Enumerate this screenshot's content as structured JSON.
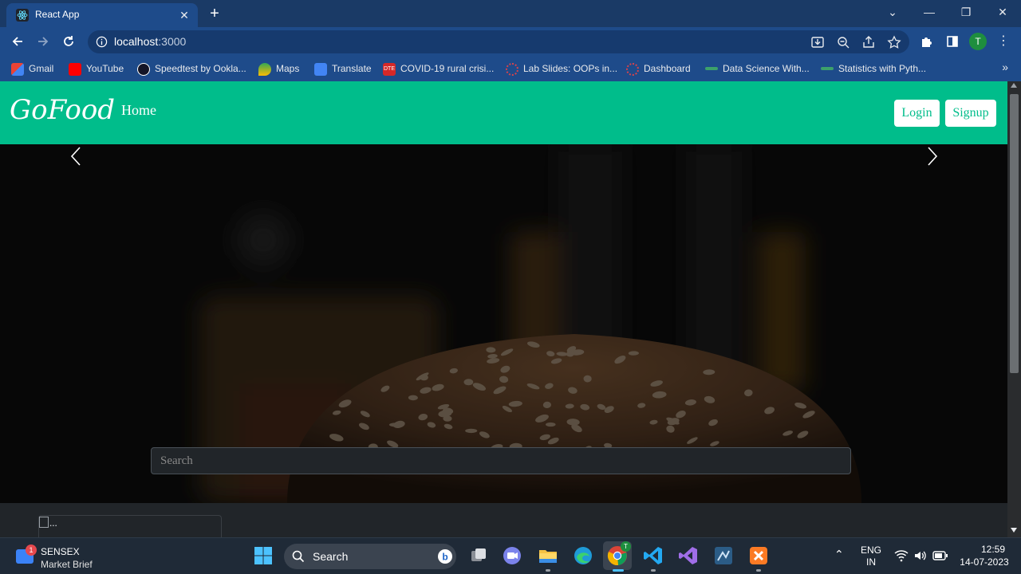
{
  "browser": {
    "tab_title": "React App",
    "url_host": "localhost",
    "url_port": ":3000",
    "profile_initial": "T",
    "bookmarks": [
      {
        "label": "Gmail",
        "icon": "gmail-icon"
      },
      {
        "label": "YouTube",
        "icon": "youtube-icon"
      },
      {
        "label": "Speedtest by Ookla...",
        "icon": "speedtest-icon"
      },
      {
        "label": "Maps",
        "icon": "maps-icon"
      },
      {
        "label": "Translate",
        "icon": "translate-icon"
      },
      {
        "label": "COVID-19 rural crisi...",
        "icon": "dte-icon"
      },
      {
        "label": "Lab Slides: OOPs in...",
        "icon": "lab-icon"
      },
      {
        "label": "Dashboard",
        "icon": "dashboard-icon"
      },
      {
        "label": "Data Science With...",
        "icon": "link-icon"
      },
      {
        "label": "Statistics with Pyth...",
        "icon": "link-icon"
      }
    ],
    "dte_badge": "DTE"
  },
  "page": {
    "brand": "GoFood",
    "nav_home": "Home",
    "login_label": "Login",
    "signup_label": "Signup",
    "search_placeholder": "Search",
    "card_img_alt": "...",
    "accent_color": "#00bd8b"
  },
  "taskbar": {
    "widget_title": "SENSEX",
    "widget_subtitle": "Market Brief",
    "widget_badge": "1",
    "search_label": "Search",
    "chrome_badge": "T",
    "lang_top": "ENG",
    "lang_bottom": "IN",
    "time": "12:59",
    "date": "14-07-2023"
  }
}
